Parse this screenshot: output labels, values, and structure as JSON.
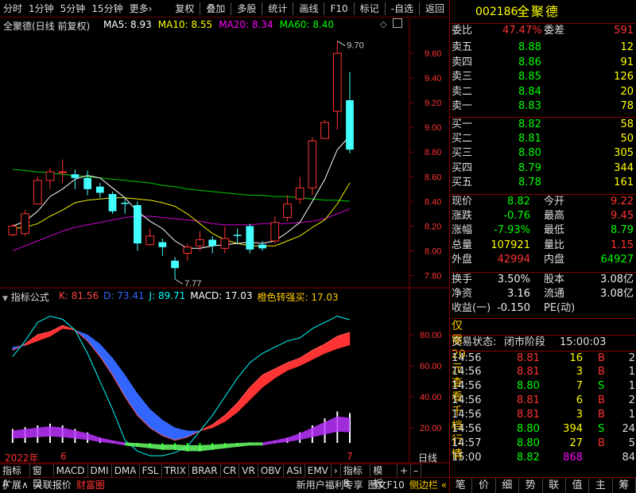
{
  "toolbar": {
    "left": [
      "分时",
      "1分钟",
      "5分钟",
      "15分钟",
      "更多›"
    ],
    "right": [
      "复权",
      "叠加",
      "多股",
      "统计",
      "画线",
      "F10",
      "标记",
      "-自选",
      "返回"
    ]
  },
  "stock": {
    "code": "002186",
    "name": "全聚德"
  },
  "chart": {
    "title": "全聚德(日线 前复权)",
    "ma": [
      {
        "label": "MA5: 8.93",
        "color": "#ffffff"
      },
      {
        "label": "MA10: 8.55",
        "color": "#ffff00"
      },
      {
        "label": "MA20: 8.34",
        "color": "#ff00ff"
      },
      {
        "label": "MA60: 8.40",
        "color": "#00ff00"
      }
    ],
    "price_ticks": [
      "9.60",
      "9.40",
      "9.20",
      "9.00",
      "8.80",
      "8.60",
      "8.40",
      "8.20",
      "8.00",
      "7.80"
    ],
    "hi_label": "9.70",
    "lo_label": "7.77",
    "ind_title": "指标公式",
    "ind": [
      {
        "label": "K: 81.56",
        "color": "#ff4444"
      },
      {
        "label": "D: 73.41",
        "color": "#3366ff"
      },
      {
        "label": "J: 89.71",
        "color": "#00ffff"
      },
      {
        "label": "MACD: 17.03",
        "color": "#ffffff"
      },
      {
        "label": "橙色转强买: 17.03",
        "color": "#ffcc00"
      }
    ],
    "ind_ticks": [
      "80.00",
      "60.00",
      "40.00",
      "20.00"
    ],
    "date_left": "2022年",
    "date_mid": "6",
    "date_right": "7",
    "day_label": "日线"
  },
  "chart_data": {
    "type": "candlestick",
    "candles": [
      [
        8.13,
        8.2,
        8.12,
        8.22
      ],
      [
        8.14,
        8.3,
        8.12,
        8.33
      ],
      [
        8.38,
        8.57,
        8.38,
        8.6
      ],
      [
        8.57,
        8.64,
        8.5,
        8.67
      ],
      [
        8.64,
        8.64,
        8.55,
        8.74
      ],
      [
        8.62,
        8.59,
        8.5,
        8.66
      ],
      [
        8.59,
        8.5,
        8.45,
        8.65
      ],
      [
        8.52,
        8.47,
        8.43,
        8.55
      ],
      [
        8.46,
        8.32,
        8.3,
        8.48
      ],
      [
        8.39,
        8.38,
        8.3,
        8.42
      ],
      [
        8.37,
        8.06,
        8.0,
        8.4
      ],
      [
        8.05,
        8.12,
        8.04,
        8.18
      ],
      [
        8.07,
        8.03,
        7.96,
        8.1
      ],
      [
        7.92,
        7.86,
        7.77,
        7.95
      ],
      [
        7.98,
        8.03,
        7.92,
        8.06
      ],
      [
        8.04,
        8.09,
        8.0,
        8.16
      ],
      [
        8.09,
        8.04,
        7.98,
        8.12
      ],
      [
        8.02,
        8.1,
        7.98,
        8.2
      ],
      [
        8.13,
        8.12,
        8.06,
        8.18
      ],
      [
        8.2,
        8.01,
        7.98,
        8.22
      ],
      [
        8.05,
        8.02,
        8.0,
        8.08
      ],
      [
        8.08,
        8.23,
        8.06,
        8.28
      ],
      [
        8.27,
        8.38,
        8.24,
        8.45
      ],
      [
        8.42,
        8.51,
        8.38,
        8.6
      ],
      [
        8.51,
        8.89,
        8.45,
        8.92
      ],
      [
        8.91,
        9.04,
        8.93,
        9.06
      ],
      [
        9.13,
        9.6,
        8.98,
        9.7
      ],
      [
        9.22,
        8.82,
        8.79,
        9.45
      ]
    ],
    "ma5": [
      8.2,
      8.24,
      8.32,
      8.44,
      8.5,
      8.58,
      8.61,
      8.59,
      8.51,
      8.43,
      8.32,
      8.24,
      8.18,
      8.08,
      8.02,
      8.02,
      8.04,
      8.05,
      8.06,
      8.07,
      8.06,
      8.08,
      8.15,
      8.23,
      8.4,
      8.58,
      8.82,
      8.93
    ],
    "ma10": [
      8.18,
      8.19,
      8.22,
      8.28,
      8.33,
      8.39,
      8.41,
      8.42,
      8.43,
      8.43,
      8.42,
      8.41,
      8.39,
      8.36,
      8.3,
      8.22,
      8.14,
      8.09,
      8.06,
      8.04,
      8.04,
      8.04,
      8.08,
      8.12,
      8.19,
      8.25,
      8.38,
      8.55
    ],
    "ma20": [
      8.0,
      8.04,
      8.08,
      8.12,
      8.16,
      8.19,
      8.21,
      8.23,
      8.25,
      8.27,
      8.28,
      8.28,
      8.27,
      8.26,
      8.25,
      8.24,
      8.22,
      8.21,
      8.21,
      8.21,
      8.22,
      8.22,
      8.22,
      8.23,
      8.24,
      8.26,
      8.3,
      8.34
    ],
    "ma60": [
      8.66,
      8.65,
      8.64,
      8.63,
      8.62,
      8.61,
      8.6,
      8.59,
      8.58,
      8.57,
      8.56,
      8.55,
      8.53,
      8.52,
      8.5,
      8.49,
      8.48,
      8.47,
      8.46,
      8.45,
      8.45,
      8.44,
      8.44,
      8.43,
      8.42,
      8.41,
      8.41,
      8.4
    ],
    "k": [
      70,
      74,
      80,
      82,
      86,
      83,
      76,
      66,
      54,
      40,
      28,
      20,
      15,
      12,
      14,
      18,
      22,
      28,
      36,
      46,
      54,
      58,
      62,
      65,
      70,
      74,
      79,
      81.56
    ],
    "d": [
      72,
      73,
      76,
      79,
      84,
      83,
      80,
      74,
      65,
      54,
      42,
      32,
      25,
      20,
      18,
      18,
      20,
      24,
      30,
      38,
      46,
      52,
      57,
      60,
      64,
      68,
      71,
      73.41
    ],
    "j": [
      66,
      76,
      88,
      92,
      90,
      83,
      68,
      50,
      32,
      12,
      5,
      2,
      2,
      4,
      8,
      18,
      28,
      40,
      52,
      62,
      68,
      72,
      76,
      78,
      84,
      88,
      92,
      89.71
    ],
    "macd": [
      8,
      9,
      10,
      11,
      10,
      8,
      6,
      3,
      1,
      -1,
      -2,
      -3,
      -4,
      -4,
      -5,
      -5,
      -4,
      -3,
      -2,
      -1,
      -1,
      1,
      3,
      6,
      10,
      14,
      18,
      17.03
    ],
    "ylim": [
      7.7,
      9.8
    ]
  },
  "panel": {
    "wb": {
      "label": "委比",
      "value": "47.47%",
      "label2": "委差",
      "value2": "591"
    },
    "sells": [
      {
        "label": "卖五",
        "price": "8.88",
        "vol": "12"
      },
      {
        "label": "卖四",
        "price": "8.86",
        "vol": "91"
      },
      {
        "label": "卖三",
        "price": "8.85",
        "vol": "126"
      },
      {
        "label": "卖二",
        "price": "8.84",
        "vol": "20"
      },
      {
        "label": "卖一",
        "price": "8.83",
        "vol": "78"
      }
    ],
    "buys": [
      {
        "label": "买一",
        "price": "8.82",
        "vol": "58"
      },
      {
        "label": "买二",
        "price": "8.81",
        "vol": "50"
      },
      {
        "label": "买三",
        "price": "8.80",
        "vol": "305"
      },
      {
        "label": "买四",
        "price": "8.79",
        "vol": "344"
      },
      {
        "label": "买五",
        "price": "8.78",
        "vol": "161"
      }
    ],
    "stats": [
      [
        {
          "t": "现价",
          "c": "lab"
        },
        {
          "t": "8.82",
          "c": "green"
        },
        {
          "t": "今开",
          "c": "lab"
        },
        {
          "t": "9.22",
          "c": "red"
        }
      ],
      [
        {
          "t": "涨跌",
          "c": "lab"
        },
        {
          "t": "-0.76",
          "c": "green"
        },
        {
          "t": "最高",
          "c": "lab"
        },
        {
          "t": "9.45",
          "c": "red"
        }
      ],
      [
        {
          "t": "涨幅",
          "c": "lab"
        },
        {
          "t": "-7.93%",
          "c": "green"
        },
        {
          "t": "最低",
          "c": "lab"
        },
        {
          "t": "8.79",
          "c": "green"
        }
      ],
      [
        {
          "t": "总量",
          "c": "lab"
        },
        {
          "t": "107921",
          "c": "yellow"
        },
        {
          "t": "量比",
          "c": "lab"
        },
        {
          "t": "1.15",
          "c": "red"
        }
      ],
      [
        {
          "t": "外盘",
          "c": "lab"
        },
        {
          "t": "42994",
          "c": "red"
        },
        {
          "t": "内盘",
          "c": "lab"
        },
        {
          "t": "64927",
          "c": "green"
        }
      ]
    ],
    "stats2": [
      [
        {
          "t": "换手",
          "c": "lab"
        },
        {
          "t": "3.50%",
          "c": "white"
        },
        {
          "t": "股本",
          "c": "lab"
        },
        {
          "t": "3.08亿",
          "c": "white"
        }
      ],
      [
        {
          "t": "净资",
          "c": "lab"
        },
        {
          "t": "3.16",
          "c": "white"
        },
        {
          "t": "流通",
          "c": "lab"
        },
        {
          "t": "3.08亿",
          "c": "white"
        }
      ],
      [
        {
          "t": "收益(一)",
          "c": "lab"
        },
        {
          "t": "-0.150",
          "c": "white"
        },
        {
          "t": "PE(动)",
          "c": "lab"
        },
        {
          "t": "",
          "c": "white"
        }
      ]
    ],
    "promo": "仅需20元查看千档行情",
    "promo_hi": "20",
    "state_label": "交易状态:",
    "state_value": "闭市阶段",
    "state_time": "15:00:03",
    "ticks": [
      {
        "time": "14:56",
        "price": "8.81",
        "vol": "16",
        "bs": "B",
        "n": "2",
        "pc": "red",
        "vc": "yellow",
        "bc": "red"
      },
      {
        "time": "14:56",
        "price": "8.81",
        "vol": "3",
        "bs": "B",
        "n": "1",
        "pc": "red",
        "vc": "yellow",
        "bc": "red"
      },
      {
        "time": "14:56",
        "price": "8.80",
        "vol": "7",
        "bs": "S",
        "n": "1",
        "pc": "green",
        "vc": "yellow",
        "bc": "green"
      },
      {
        "time": "14:56",
        "price": "8.81",
        "vol": "6",
        "bs": "B",
        "n": "2",
        "pc": "red",
        "vc": "yellow",
        "bc": "red"
      },
      {
        "time": "14:56",
        "price": "8.81",
        "vol": "3",
        "bs": "B",
        "n": "1",
        "pc": "red",
        "vc": "yellow",
        "bc": "red"
      },
      {
        "time": "14:56",
        "price": "8.80",
        "vol": "394",
        "bs": "S",
        "n": "24",
        "pc": "green",
        "vc": "yellow",
        "bc": "green"
      },
      {
        "time": "14:57",
        "price": "8.80",
        "vol": "27",
        "bs": "B",
        "n": "5",
        "pc": "green",
        "vc": "yellow",
        "bc": "red"
      },
      {
        "time": "15:00",
        "price": "8.82",
        "vol": "868",
        "bs": "",
        "n": "84",
        "pc": "green",
        "vc": "mag",
        "bc": "red"
      }
    ]
  },
  "tabs": [
    "指标A",
    "窗口",
    "MACD",
    "DMI",
    "DMA",
    "FSL",
    "TRIX",
    "BRAR",
    "CR",
    "VR",
    "OBV",
    "ASI",
    "EMV",
    "›",
    "指标B",
    "模 板",
    "+",
    "–"
  ],
  "bottom": {
    "left": [
      "扩展∧",
      "关联报价",
      "财富圈"
    ],
    "right": [
      "新用户福利专享",
      "图文F10",
      "侧边栏 «"
    ]
  },
  "rbot": [
    "笔",
    "价",
    "细",
    "势",
    "联",
    "值",
    "主",
    "筹"
  ]
}
